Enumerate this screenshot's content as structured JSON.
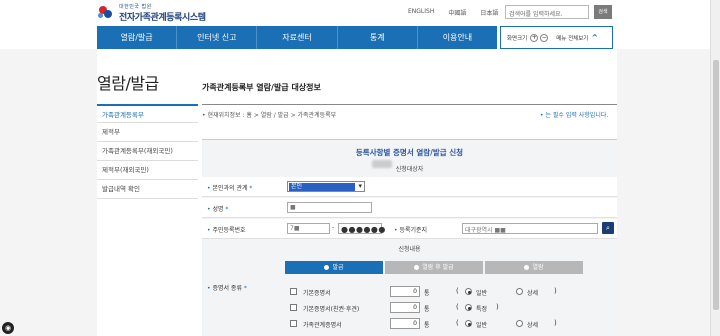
{
  "header": {
    "logo_small": "대한민국 법원",
    "logo_title": "전자가족관계등록시스템",
    "langs": [
      "ENGLISH",
      "中國語",
      "日本語"
    ],
    "search_placeholder": "검색어를 입력하세요.",
    "search_button": "검색"
  },
  "nav": {
    "items": [
      "열람/발급",
      "인터넷 신고",
      "자료센터",
      "통계",
      "이용안내"
    ],
    "zoom_label": "화면크기",
    "zoom_plus": "+",
    "zoom_minus": "−",
    "all_menu": "메뉴 전체보기"
  },
  "sidebar": {
    "title": "열람/발급",
    "items": [
      "가족관계등록부",
      "제적부",
      "가족관계등록부(재외국민)",
      "제적부(재외국민)",
      "발급내역 확인"
    ]
  },
  "main": {
    "page_title": "가족관계등록부 열람/발급 대상정보",
    "breadcrumb": "• 현재위치정보 : 홈 > 열람 / 발급 > 가족관계등록부",
    "required_note": "• 는 필수 입력 사항입니다."
  },
  "form": {
    "title": "등록사항별 증명서 열람/발급 신청",
    "section_target": "신청대상자",
    "relation_label": "본인과의 관계",
    "relation_value": "본인",
    "name_label": "성명",
    "name_value": "■",
    "rrn_label": "주민등록번호",
    "rrn_front": "7■",
    "rrn_back": "●●●●●●",
    "reg_base_label": "등록기준지",
    "reg_base_value": "대구광역시 ■■",
    "section_content": "신청내용",
    "tabs": [
      "발급",
      "열람 후 발급",
      "열람"
    ],
    "cert_type_label": "증명서 종류",
    "cert_items": [
      {
        "name": "기본증명서",
        "count": "0",
        "unit": "통",
        "opt1": "일반",
        "opt2": "상세",
        "selected": 1
      },
      {
        "name": "기본증명서(친권·후견)",
        "count": "0",
        "unit": "통",
        "opt1": "특정",
        "opt2": "",
        "selected": 1
      },
      {
        "name": "가족관계증명서",
        "count": "0",
        "unit": "통",
        "opt1": "일반",
        "opt2": "상세",
        "selected": 1
      }
    ]
  }
}
